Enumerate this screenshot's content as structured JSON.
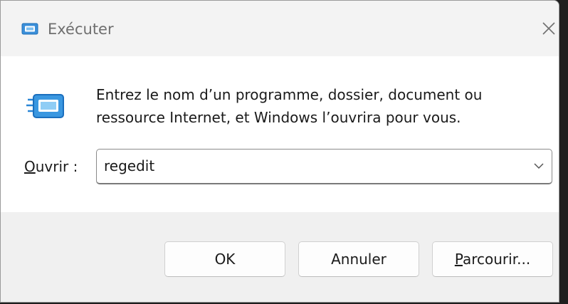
{
  "window": {
    "title": "Exécuter",
    "title_icon": "run-icon",
    "close_icon": "close-icon"
  },
  "dialog": {
    "icon": "run-icon",
    "message_line1": "Entrez le nom d’un programme, dossier, document ou",
    "message_line2": "ressource Internet, et Windows l’ouvrira pour vous.",
    "open_label_mnemonic": "O",
    "open_label_rest": "uvrir :",
    "open_value": "regedit",
    "dropdown_icon": "chevron-down-icon"
  },
  "buttons": {
    "ok": "OK",
    "cancel": "Annuler",
    "browse_mnemonic": "P",
    "browse_rest": "arcourir..."
  },
  "colors": {
    "accent": "#0067c0",
    "titlebar_bg": "#f3f3f3",
    "footer_bg": "#f0f0f0"
  }
}
